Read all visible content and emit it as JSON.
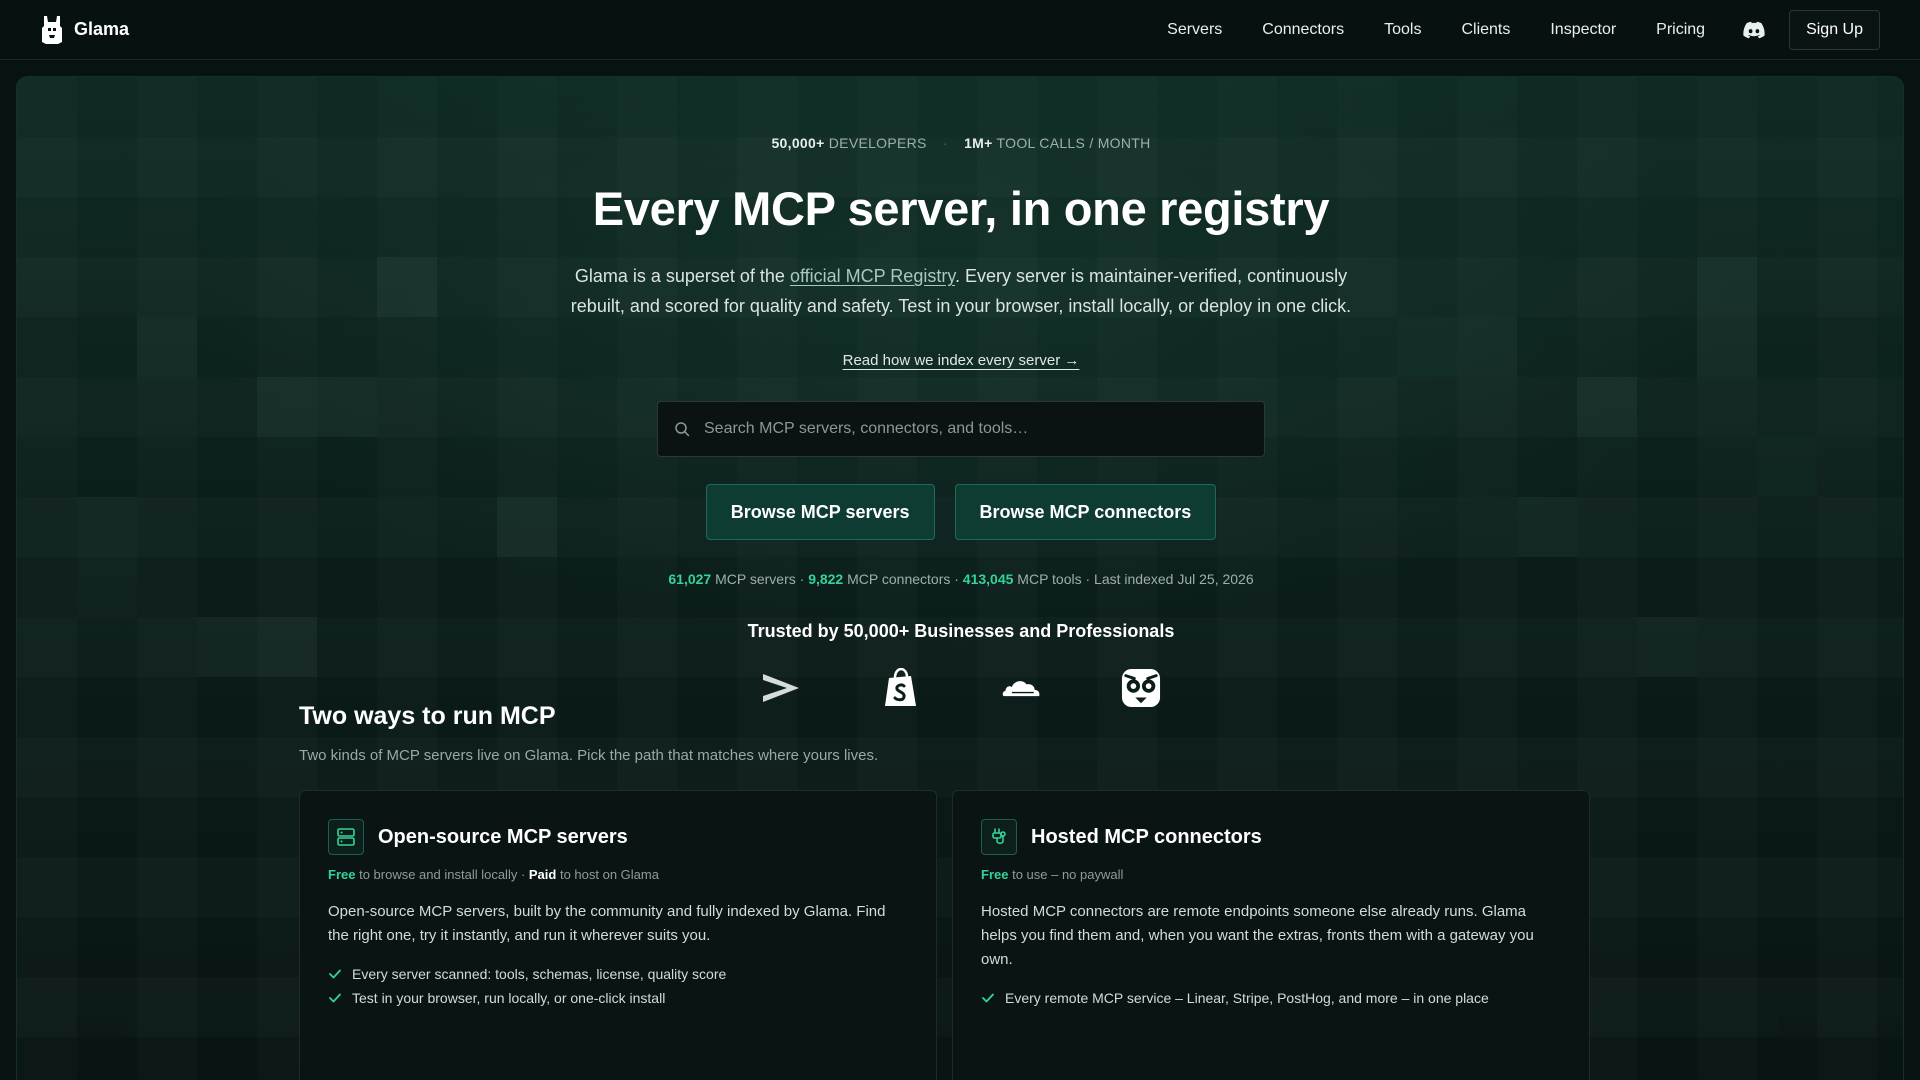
{
  "header": {
    "brand": "Glama",
    "nav": [
      "Servers",
      "Connectors",
      "Tools",
      "Clients",
      "Inspector",
      "Pricing"
    ],
    "signup_label": "Sign Up"
  },
  "hero": {
    "stats": [
      {
        "value": "50,000+",
        "label": "DEVELOPERS"
      },
      {
        "value": "1M+",
        "label": "TOOL CALLS / MONTH"
      }
    ],
    "headline": "Every MCP server, in one registry",
    "subtext_before": "Glama is a superset of the ",
    "subtext_link": "official MCP Registry",
    "subtext_after": ". Every server is maintainer-verified, continuously rebuilt, and scored for quality and safety. Test in your browser, install locally, or deploy in one click.",
    "read_link": "Read how we index every server →",
    "search_placeholder": "Search MCP servers, connectors, and tools…",
    "cta_servers": "Browse MCP servers",
    "cta_connectors": "Browse MCP connectors",
    "counts": {
      "servers_value": "61,027",
      "servers_label": " MCP servers · ",
      "connectors_value": "9,822",
      "connectors_label": " MCP connectors · ",
      "tools_value": "413,045",
      "tools_label": " MCP tools · Last indexed Jul 25, 2026"
    },
    "trusted_title": "Trusted by 50,000+ Businesses and Professionals",
    "trusted_logos": [
      "accenture-logo",
      "shopify-logo",
      "cloudflare-logo",
      "duolingo-logo"
    ]
  },
  "section": {
    "title": "Two ways to run MCP",
    "subtitle": "Two kinds of MCP servers live on Glama. Pick the path that matches where yours lives.",
    "cards": [
      {
        "title": "Open-source MCP servers",
        "free_label": "Free",
        "meta_middle": " to browse and install locally · ",
        "paid_label": "Paid",
        "meta_end": " to host on Glama",
        "desc": "Open-source MCP servers, built by the community and fully indexed by Glama. Find the right one, try it instantly, and run it wherever suits you.",
        "checks": [
          "Every server scanned: tools, schemas, license, quality score",
          "Test in your browser, run locally, or one-click install"
        ]
      },
      {
        "title": "Hosted MCP connectors",
        "free_label": "Free",
        "meta_end": " to use – no paywall",
        "desc": "Hosted MCP connectors are remote endpoints someone else already runs. Glama helps you find them and, when you want the extras, fronts them with a gateway you own.",
        "checks": [
          "Every remote MCP service – Linear, Stripe, PostHog, and more – in one place"
        ]
      }
    ]
  },
  "colors": {
    "accent_green": "#34d399",
    "cta_bg": "#0e3c33",
    "page_bg": "#071313"
  }
}
